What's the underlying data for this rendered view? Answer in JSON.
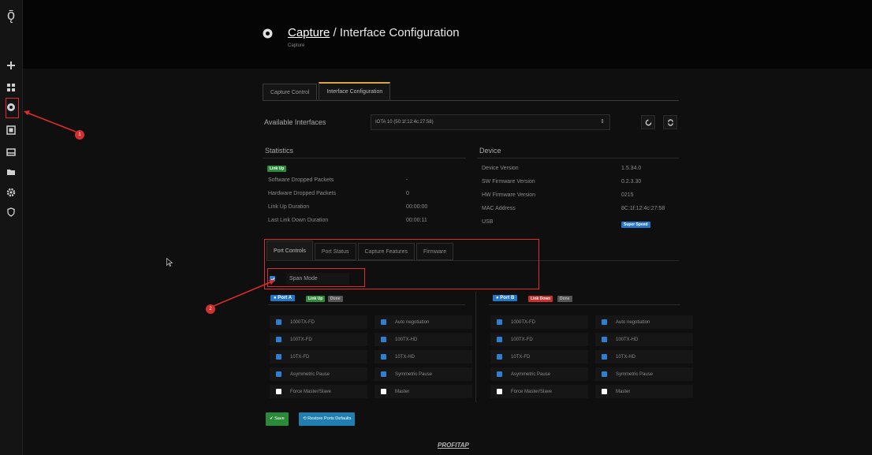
{
  "sidebar": {
    "logo": "ǭ",
    "items": [
      {
        "icon": "plus-icon"
      },
      {
        "icon": "dashboard-icon"
      },
      {
        "icon": "capture-icon"
      },
      {
        "icon": "device-icon"
      },
      {
        "icon": "storage-icon"
      },
      {
        "icon": "folder-icon"
      },
      {
        "icon": "settings-icon"
      },
      {
        "icon": "shield-icon"
      }
    ]
  },
  "header": {
    "title_link": "Capture",
    "title_rest": " / Interface Configuration",
    "subtitle": "Capture"
  },
  "tabs": [
    "Capture Control",
    "Interface Configuration"
  ],
  "interfaces": {
    "label": "Available Interfaces",
    "selected": "IOTA 10 (50:1f:12:4c:27:58)"
  },
  "statistics": {
    "title": "Statistics",
    "status_badge": "Link Up",
    "rows": [
      {
        "label": "Software Dropped Packets",
        "value": "-"
      },
      {
        "label": "Hardware Dropped Packets",
        "value": "0"
      },
      {
        "label": "Link Up Duration",
        "value": "00:00:00"
      },
      {
        "label": "Last Link Down Duration",
        "value": "00:00:11"
      }
    ]
  },
  "device": {
    "title": "Device",
    "rows": [
      {
        "label": "Device Version",
        "value": "1.5.34.0"
      },
      {
        "label": "SW Firmware Version",
        "value": "0.2.3.30"
      },
      {
        "label": "HW Firmware Version",
        "value": "0215"
      },
      {
        "label": "MAC Address",
        "value": "8C:1f:12:4c:27:58"
      },
      {
        "label": "USB",
        "value": "Super Speed"
      }
    ]
  },
  "sub_tabs": [
    "Port Controls",
    "Port Status",
    "Capture Features",
    "Firmware"
  ],
  "span_mode": {
    "label": "Span Mode",
    "checked": true
  },
  "port_a": {
    "title": "Port A",
    "link_badge": "Link Up",
    "extra_badge": "Done",
    "options": [
      {
        "label": "1000TX-FD",
        "checked": true
      },
      {
        "label": "Auto negotiation",
        "checked": true
      },
      {
        "label": "100TX-FD",
        "checked": true
      },
      {
        "label": "100TX-HD",
        "checked": true
      },
      {
        "label": "10TX-FD",
        "checked": true
      },
      {
        "label": "10TX-HD",
        "checked": true
      },
      {
        "label": "Asymmetric Pause",
        "checked": true
      },
      {
        "label": "Symmetric Pause",
        "checked": true
      },
      {
        "label": "Force Master/Slave",
        "checked": false
      },
      {
        "label": "Master",
        "checked": false
      }
    ]
  },
  "port_b": {
    "title": "Port B",
    "link_badge": "Link Down",
    "extra_badge": "Done",
    "options": [
      {
        "label": "1000TX-FD",
        "checked": true
      },
      {
        "label": "Auto negotiation",
        "checked": true
      },
      {
        "label": "100TX-FD",
        "checked": true
      },
      {
        "label": "100TX-HD",
        "checked": true
      },
      {
        "label": "10TX-FD",
        "checked": true
      },
      {
        "label": "10TX-HD",
        "checked": true
      },
      {
        "label": "Asymmetric Pause",
        "checked": true
      },
      {
        "label": "Symmetric Pause",
        "checked": true
      },
      {
        "label": "Force Master/Slave",
        "checked": false
      },
      {
        "label": "Master",
        "checked": false
      }
    ]
  },
  "buttons": {
    "save": "✔ Save",
    "restore": "⟲ Restore Ports Defaults"
  },
  "footer": "PROFITAP",
  "annotations": [
    "1",
    "2"
  ],
  "colors": {
    "accent": "#d9a441",
    "checkbox": "#2f7fd0",
    "annotation": "#e02b2b"
  }
}
